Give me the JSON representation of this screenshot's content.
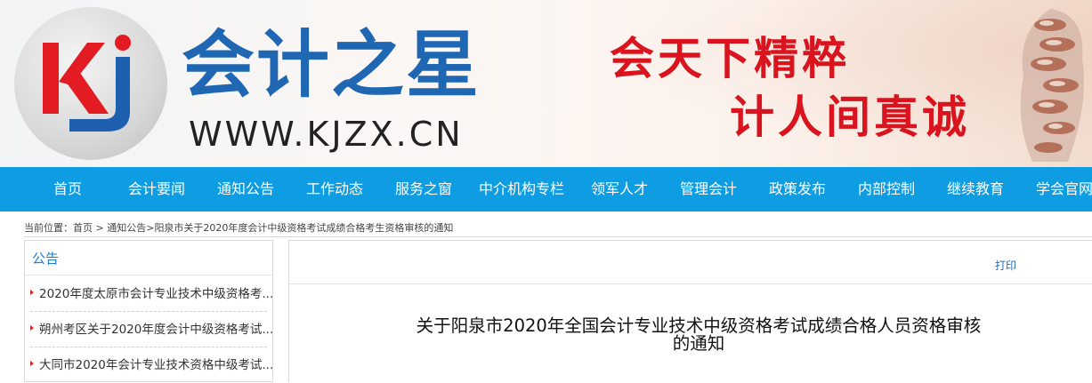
{
  "header": {
    "logo_letters": "Kj",
    "site_name": "会计之星",
    "site_url": "WWW.KJZX.CN",
    "slogan_line1": "会天下精粹",
    "slogan_line2": "计人间真诚"
  },
  "nav": {
    "items": [
      "首页",
      "会计要闻",
      "通知公告",
      "工作动态",
      "服务之窗",
      "中介机构专栏",
      "领军人才",
      "管理会计",
      "政策发布",
      "内部控制",
      "继续教育",
      "学会官网"
    ]
  },
  "breadcrumb": {
    "prefix": "当前位置：",
    "home": "首页",
    "sep": " > ",
    "section": "通知公告",
    "sep2": ">",
    "current": "阳泉市关于2020年度会计中级资格考试成绩合格考生资格审核的通知"
  },
  "sidebar": {
    "title": "公告",
    "items": [
      "2020年度太原市会计专业技术中级资格考...",
      "朔州考区关于2020年度会计中级资格考试...",
      "大同市2020年会计专业技术资格中级考试..."
    ]
  },
  "article": {
    "print_label": "打印",
    "title_line1": "关于阳泉市2020年全国会计专业技术中级资格考试成绩合格人员资格审核",
    "title_line2": "的通知"
  },
  "colors": {
    "nav_bg": "#0e9de2",
    "brand_blue": "#1f66b3",
    "slogan_red": "#d9141e"
  }
}
